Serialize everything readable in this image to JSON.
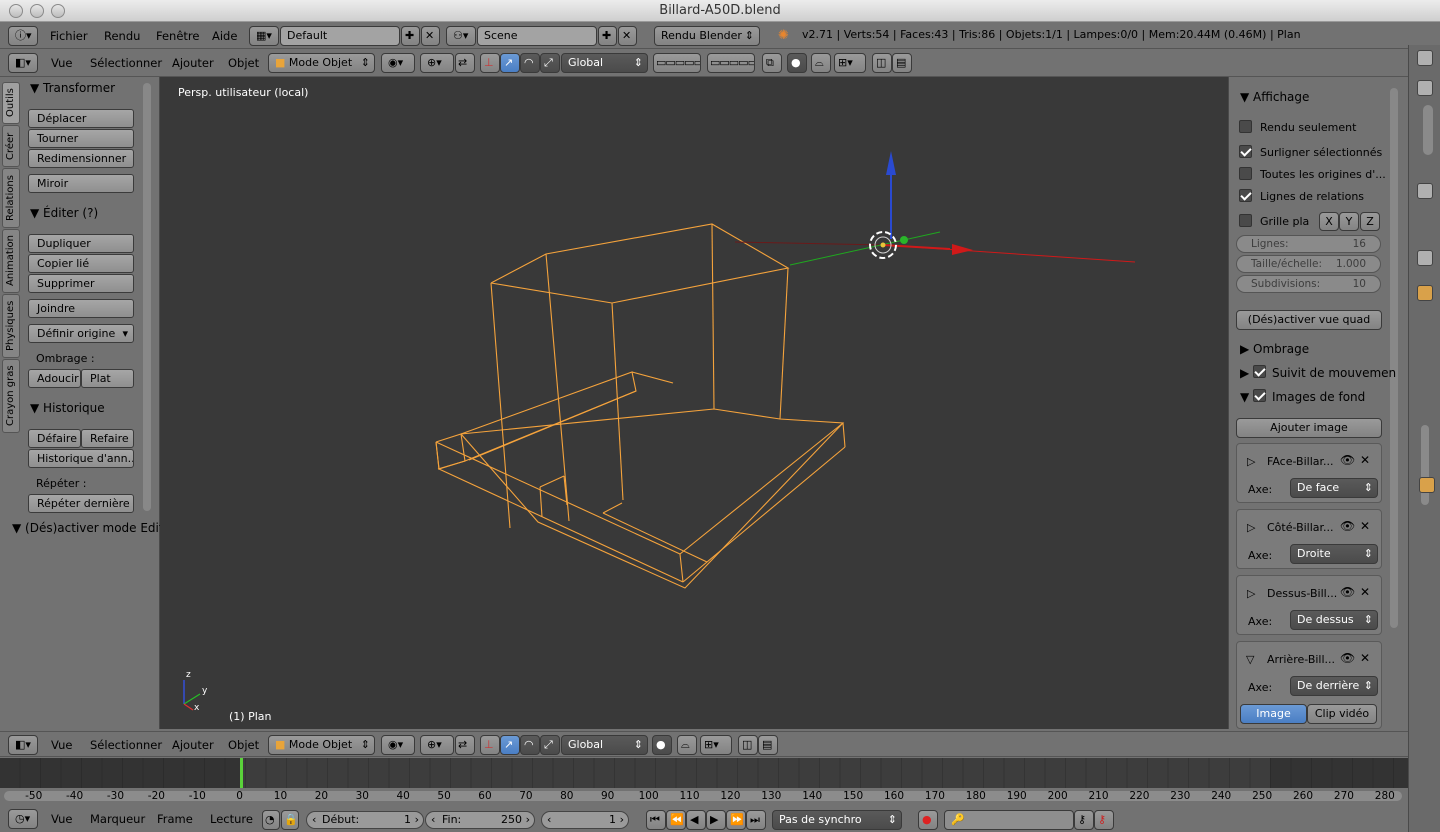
{
  "window": {
    "title": "Billard-A50D.blend"
  },
  "infobar": {
    "menus": [
      "Fichier",
      "Rendu",
      "Fenêtre",
      "Aide"
    ],
    "layout": "Default",
    "scene": "Scene",
    "engine": "Rendu Blender",
    "stats": "v2.71 | Verts:54 | Faces:43 | Tris:86 | Objets:1/1 | Lampes:0/0 | Mem:20.44M (0.46M) | Plan"
  },
  "header3d": {
    "menus": [
      "Vue",
      "Sélectionner",
      "Ajouter",
      "Objet"
    ],
    "mode": "Mode Objet",
    "orientation": "Global"
  },
  "toolshelf": {
    "tabs": [
      "Outils",
      "Créer",
      "Relations",
      "Animation",
      "Physiques",
      "Crayon gras"
    ],
    "transform_title": "Transformer",
    "transform_buttons": [
      "Déplacer",
      "Tourner",
      "Redimensionner"
    ],
    "mirror": "Miroir",
    "edit_title": "Éditer (?)",
    "edit_buttons": [
      "Dupliquer",
      "Copier lié",
      "Supprimer"
    ],
    "join": "Joindre",
    "origin": "Définir origine",
    "shading_label": "Ombrage :",
    "smooth": "Adoucir",
    "flat": "Plat",
    "history_title": "Historique",
    "undo": "Défaire",
    "redo": "Refaire",
    "undo_history": "Historique d'ann...",
    "repeat_label": "Répéter :",
    "repeat_last": "Répéter dernière",
    "toggle_edit": "(Dés)activer mode Edit"
  },
  "viewport": {
    "label": "Persp. utilisateur (local)",
    "object_label": "(1) Plan",
    "axis": {
      "x": "x",
      "y": "y",
      "z": "z"
    }
  },
  "properties": {
    "display_title": "Affichage",
    "render_only": "Rendu seulement",
    "highlight": "Surligner sélectionnés",
    "all_origins": "Toutes les origines d'...",
    "relations": "Lignes de relations",
    "grid_floor": "Grille pla",
    "axis_x": "X",
    "axis_y": "Y",
    "axis_z": "Z",
    "lines_label": "Lignes:",
    "lines_value": "16",
    "scale_label": "Taille/échelle:",
    "scale_value": "1.000",
    "subdiv_label": "Subdivisions:",
    "subdiv_value": "10",
    "quad": "(Dés)activer vue quad",
    "shading_title": "Ombrage",
    "motion_title": "Suivit de mouvemen",
    "bg_title": "Images de fond",
    "add_image": "Ajouter image",
    "axis_label": "Axe:",
    "bg_images": [
      {
        "name": "FAce-Billar...",
        "axis": "De face"
      },
      {
        "name": "Côté-Billar...",
        "axis": "Droite"
      },
      {
        "name": "Dessus-Bill...",
        "axis": "De dessus"
      },
      {
        "name": "Arrière-Bill...",
        "axis": "De derrière"
      }
    ],
    "src_image": "Image",
    "src_clip": "Clip vidéo"
  },
  "timeline": {
    "ticks": [
      "-50",
      "-40",
      "-30",
      "-20",
      "-10",
      "0",
      "10",
      "20",
      "30",
      "40",
      "50",
      "60",
      "70",
      "80",
      "90",
      "100",
      "110",
      "120",
      "130",
      "140",
      "150",
      "160",
      "170",
      "180",
      "190",
      "200",
      "210",
      "220",
      "230",
      "240",
      "250",
      "260",
      "270",
      "280"
    ],
    "menus": [
      "Vue",
      "Marqueur",
      "Frame",
      "Lecture"
    ],
    "start_label": "Début:",
    "start_value": "1",
    "end_label": "Fin:",
    "end_value": "250",
    "current": "1",
    "sync": "Pas de synchro"
  },
  "colors": {
    "wire": "#f5a33c",
    "viewport_bg": "#393939",
    "accent": "#5680c2"
  }
}
